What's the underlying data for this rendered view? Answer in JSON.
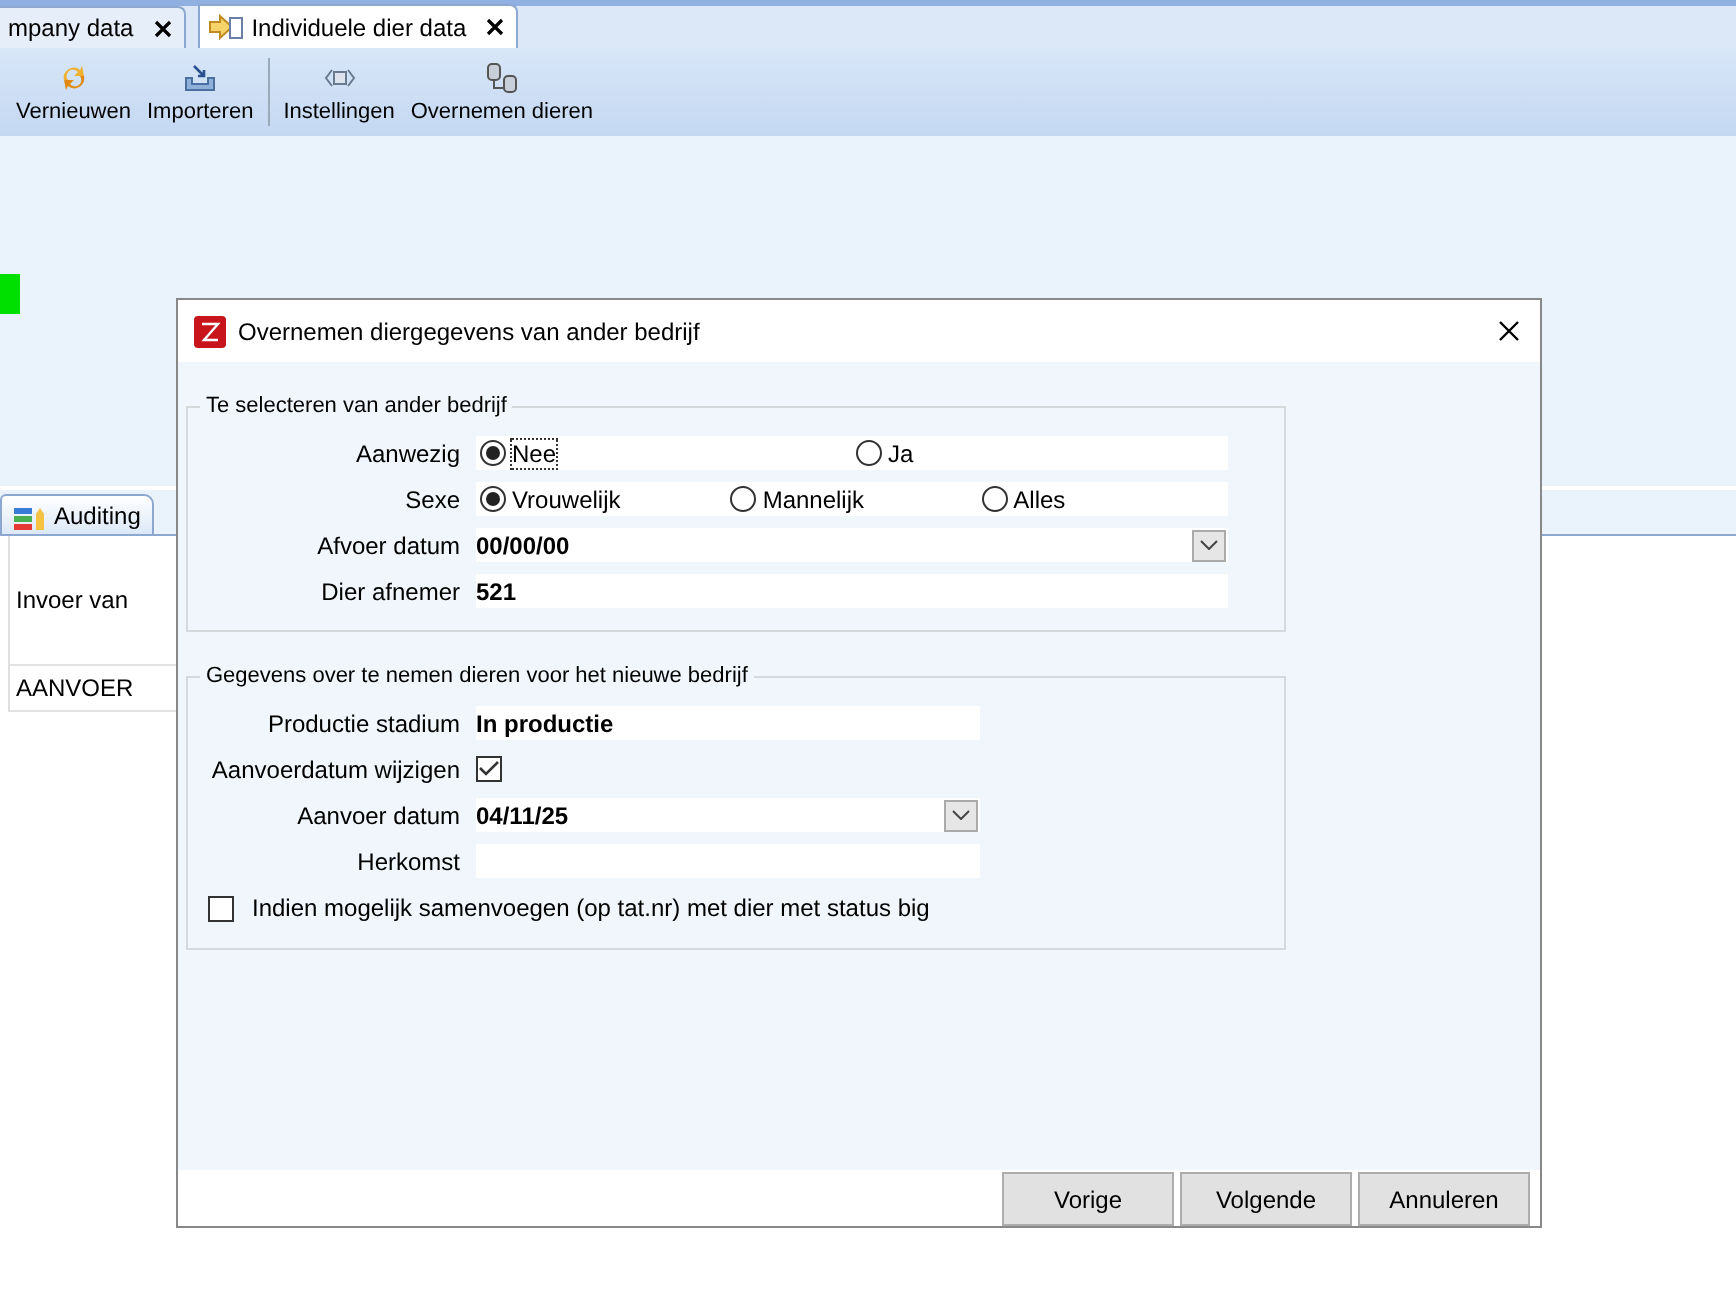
{
  "app": {
    "tabs": [
      {
        "label": "mpany data",
        "selected": false
      },
      {
        "label": "Individuele dier data",
        "selected": true
      }
    ],
    "toolbar": [
      {
        "label": "Vernieuwen"
      },
      {
        "label": "Importeren"
      },
      {
        "label": "Instellingen"
      },
      {
        "label": "Overnemen dieren"
      }
    ],
    "lower_tabs": [
      {
        "label": "Auditing"
      }
    ],
    "table_rows": [
      "Invoer van",
      "AANVOER"
    ]
  },
  "dialog": {
    "title": "Overnemen diergegevens van ander bedrijf",
    "groups": [
      {
        "title": "Te selecteren van ander bedrijf",
        "fields": [
          {
            "kind": "radio",
            "label": "Aanwezig",
            "options": [
              {
                "label": "Nee",
                "selected": true,
                "focused": true
              },
              {
                "label": "Ja",
                "selected": false,
                "focused": false
              }
            ]
          },
          {
            "kind": "radio",
            "label": "Sexe",
            "options": [
              {
                "label": "Vrouwelijk",
                "selected": true,
                "focused": false
              },
              {
                "label": "Mannelijk",
                "selected": false,
                "focused": false
              },
              {
                "label": "Alles",
                "selected": false,
                "focused": false
              }
            ]
          },
          {
            "kind": "date",
            "label": "Afvoer datum",
            "value": "00/00/00"
          },
          {
            "kind": "text",
            "label": "Dier afnemer",
            "value": "521"
          }
        ]
      },
      {
        "title": "Gegevens over te nemen dieren voor het nieuwe bedrijf",
        "fields": [
          {
            "kind": "text",
            "label": "Productie stadium",
            "value": "In productie"
          },
          {
            "kind": "checkbox",
            "label": "Aanvoerdatum wijzigen",
            "checked": true
          },
          {
            "kind": "date",
            "label": "Aanvoer datum",
            "value": "04/11/25"
          },
          {
            "kind": "text",
            "label": "Herkomst"
          },
          {
            "kind": "check_row",
            "label": "Indien mogelijk samenvoegen (op tat.nr) met dier met status big",
            "checked": false
          }
        ]
      }
    ],
    "buttons": [
      "Vorige",
      "Volgende",
      "Annuleren"
    ]
  }
}
